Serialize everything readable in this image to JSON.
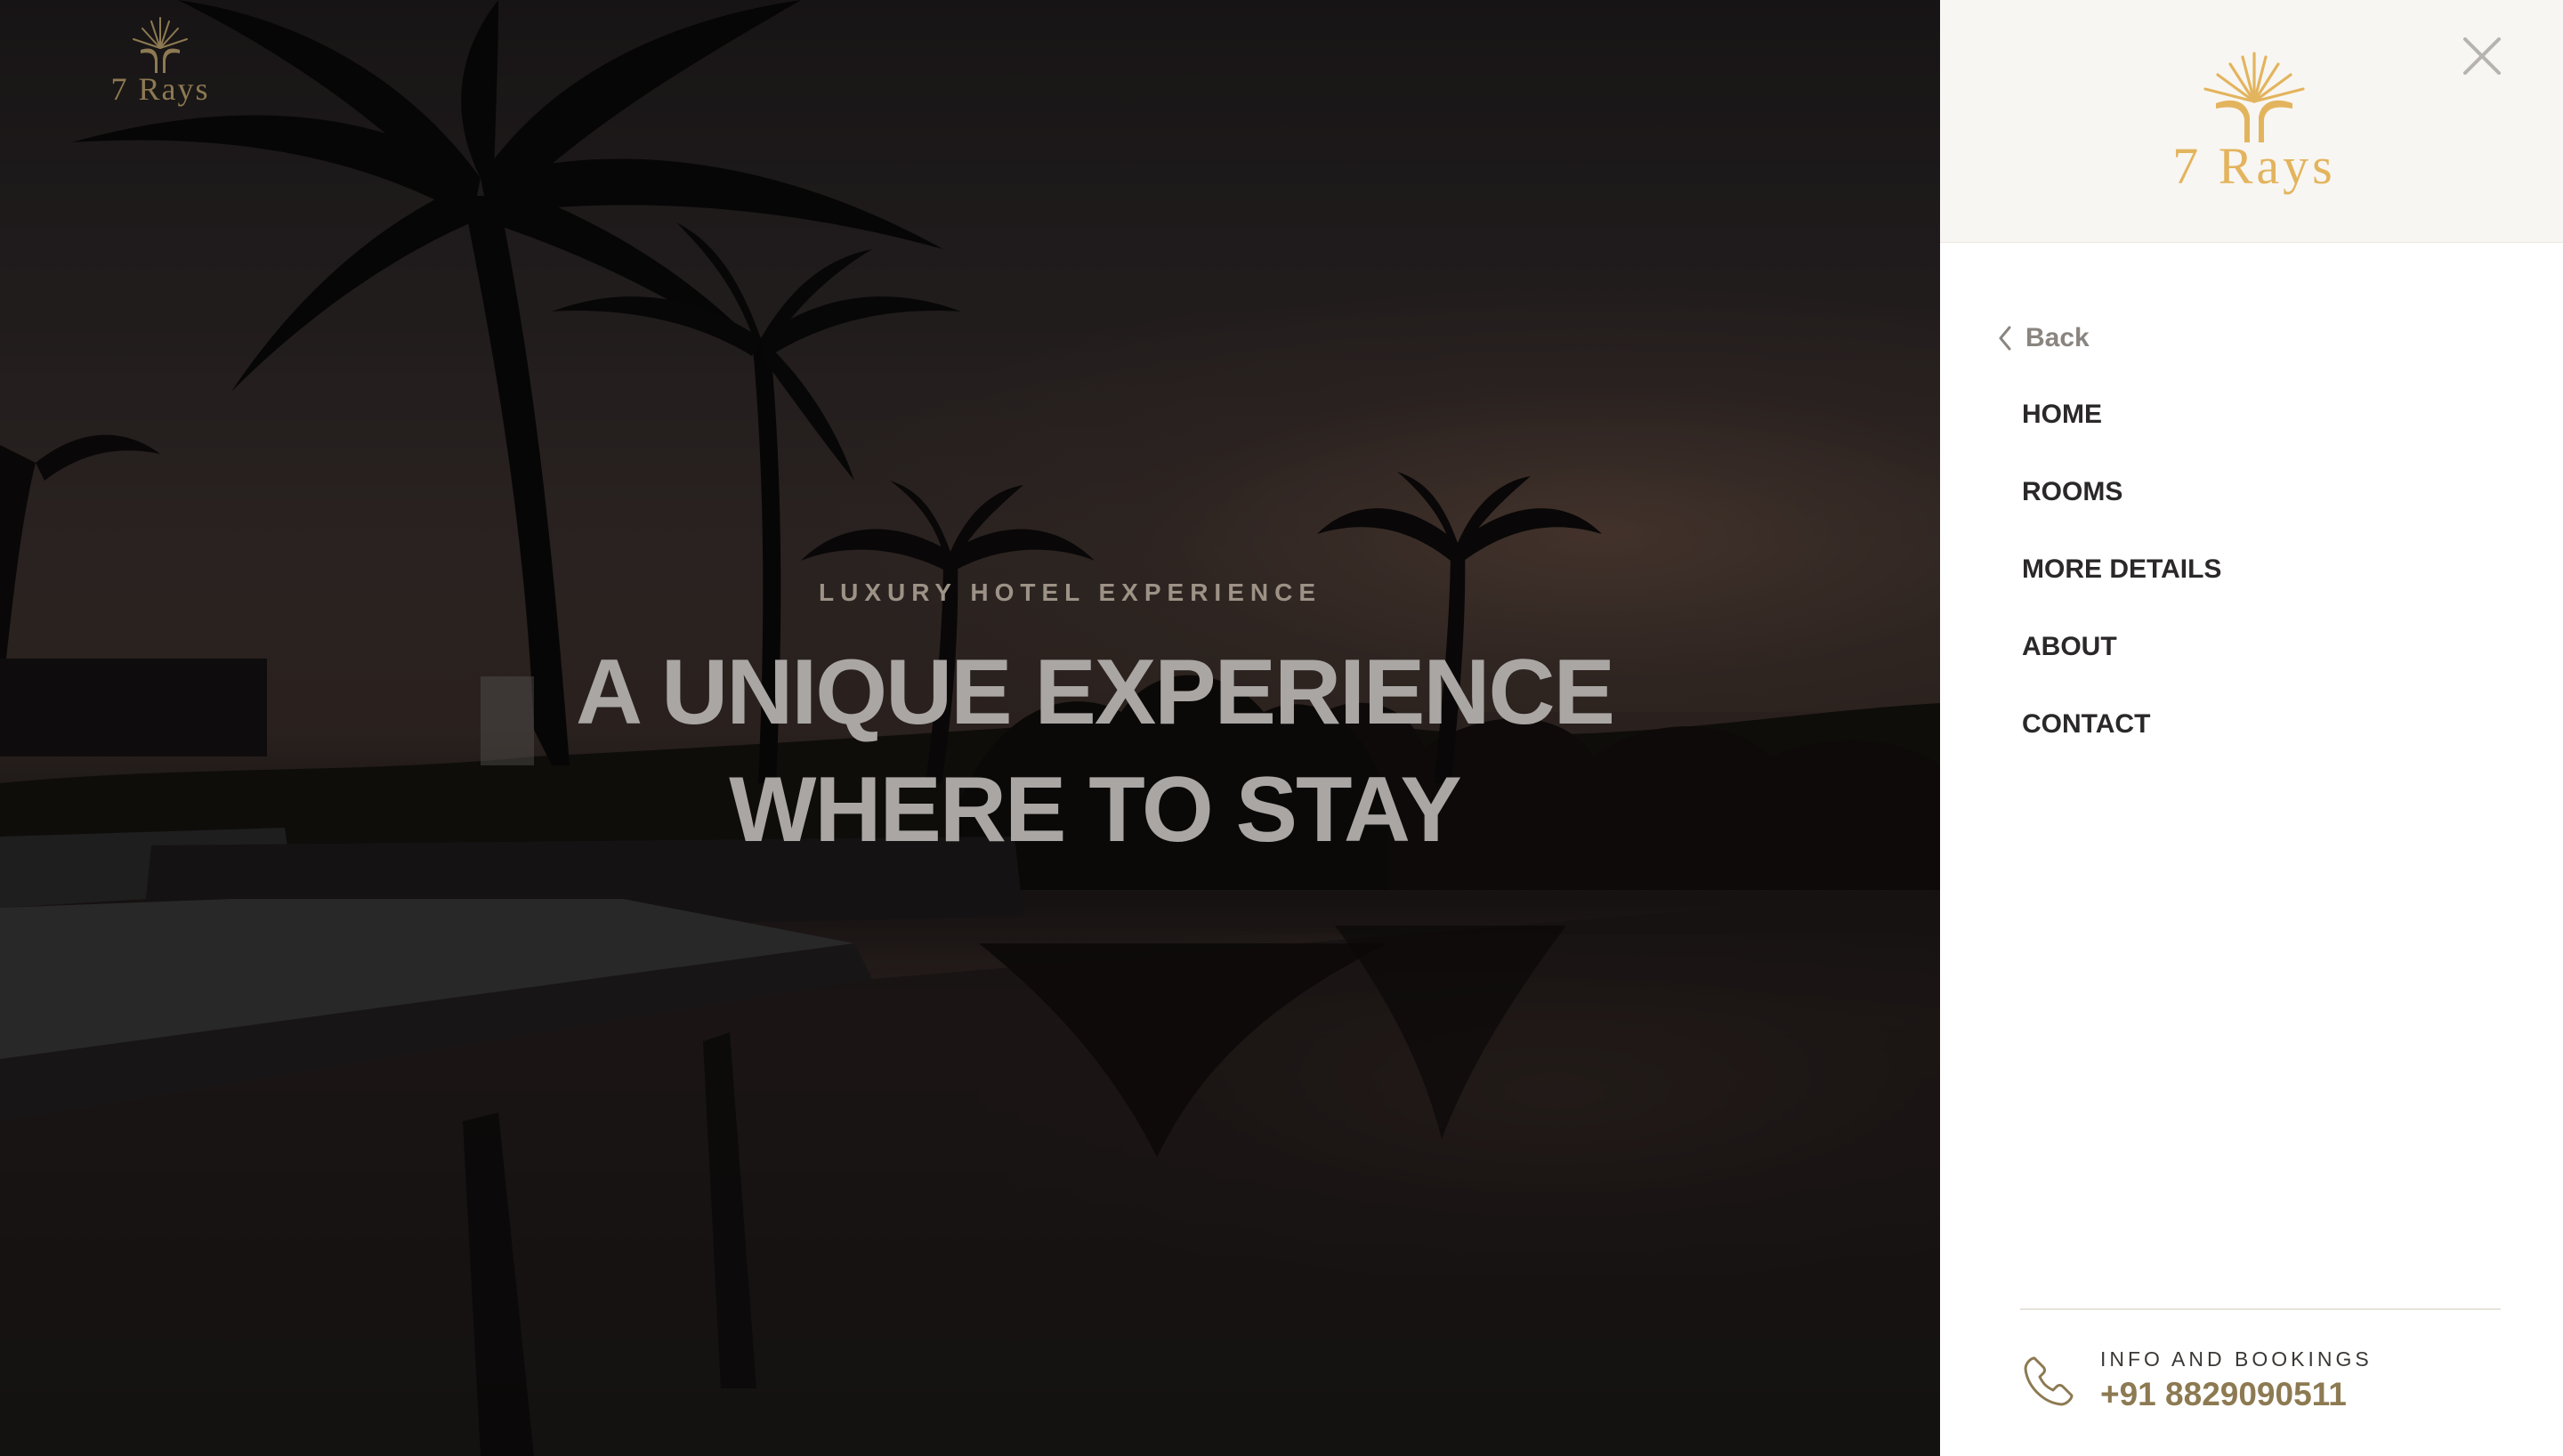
{
  "brand": {
    "name": "7 Rays",
    "accent_color": "#e3b45e",
    "muted_logo_color": "#8d7a52"
  },
  "hero": {
    "kicker": "LUXURY HOTEL EXPERIENCE",
    "heading_line_1": "A UNIQUE EXPERIENCE",
    "heading_line_2": "WHERE TO STAY",
    "background": "sunset-palm-pool-photo"
  },
  "sidebar": {
    "close_icon": "close-icon",
    "back_label": "Back",
    "menu": [
      {
        "label": "HOME"
      },
      {
        "label": "ROOMS"
      },
      {
        "label": "MORE DETAILS"
      },
      {
        "label": "ABOUT"
      },
      {
        "label": "CONTACT"
      }
    ],
    "contact": {
      "icon": "phone-icon",
      "label": "INFO AND BOOKINGS",
      "phone": "+91 8829090511"
    }
  }
}
